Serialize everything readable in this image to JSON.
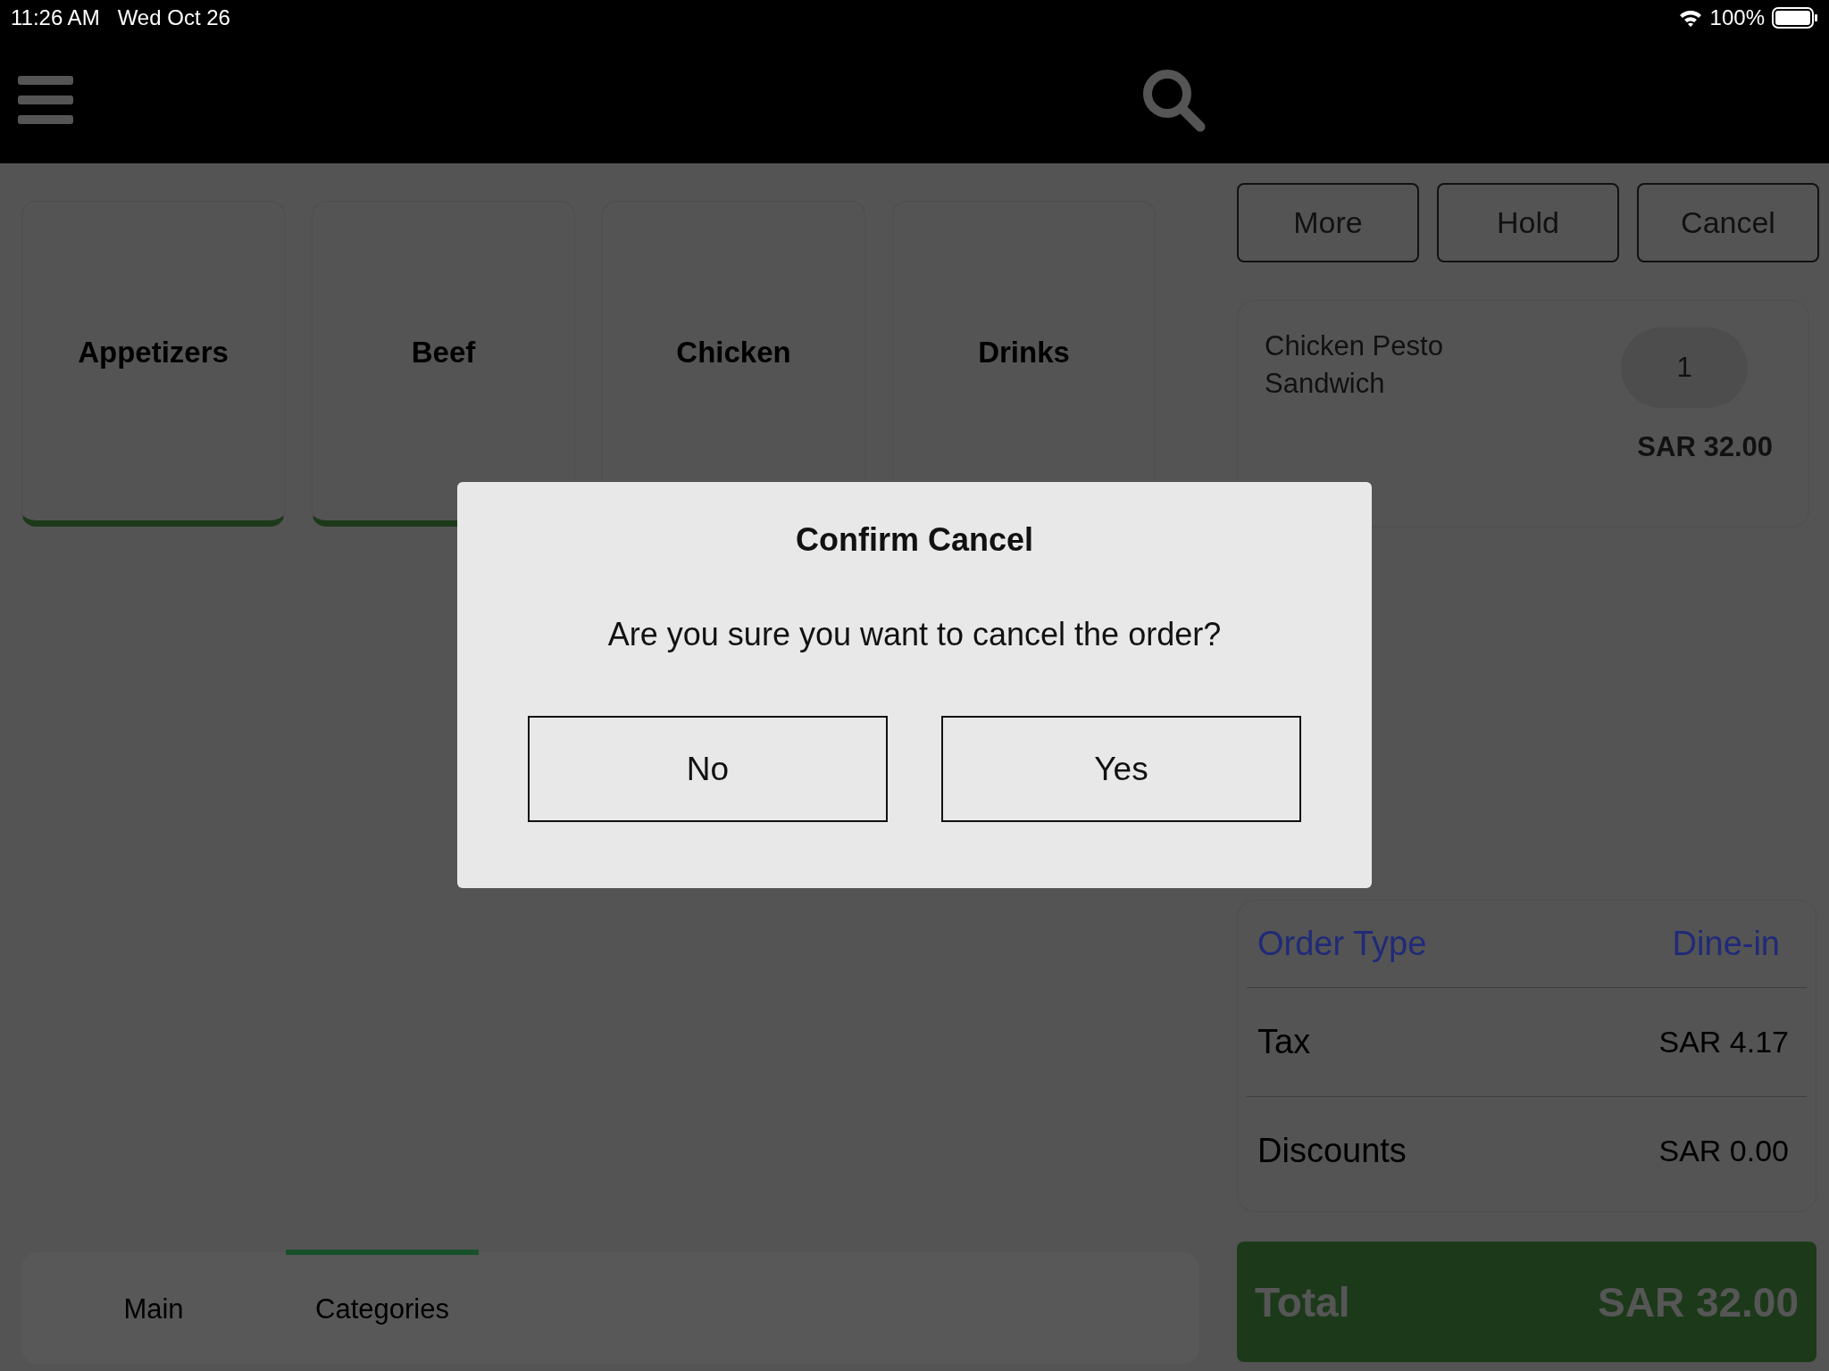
{
  "status_bar": {
    "time": "11:26 AM",
    "date": "Wed Oct 26",
    "battery": "100%"
  },
  "categories": [
    {
      "label": "Appetizers"
    },
    {
      "label": "Beef"
    },
    {
      "label": "Chicken"
    },
    {
      "label": "Drinks"
    }
  ],
  "bottom_tabs": [
    {
      "label": "Main",
      "selected": false
    },
    {
      "label": "Categories",
      "selected": true
    }
  ],
  "actions": [
    "More",
    "Hold",
    "Cancel"
  ],
  "order_items": [
    {
      "name": "Chicken Pesto Sandwich",
      "quantity": "1",
      "price": "SAR 32.00"
    }
  ],
  "summary": {
    "order_type_label": "Order Type",
    "order_type": "Dine-in",
    "rows": [
      {
        "label": "Tax",
        "value": "SAR 4.17"
      },
      {
        "label": "Discounts",
        "value": "SAR 0.00"
      }
    ]
  },
  "total": {
    "label": "Total",
    "value": "SAR 32.00"
  },
  "dialog": {
    "title": "Confirm Cancel",
    "message": "Are you sure you want to cancel the order?",
    "buttons": [
      "No",
      "Yes"
    ]
  }
}
